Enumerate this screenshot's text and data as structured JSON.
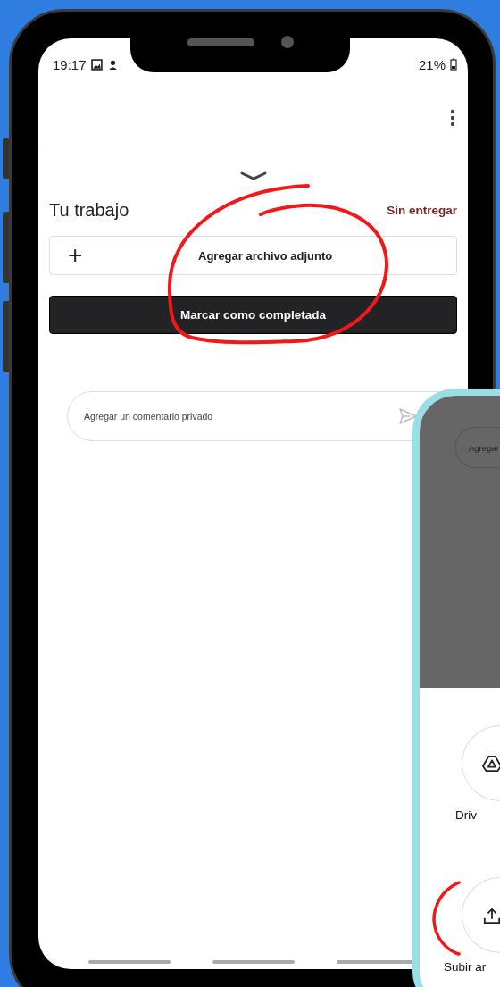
{
  "status_bar": {
    "time": "19:17",
    "battery": "21%"
  },
  "work": {
    "title": "Tu trabajo",
    "status": "Sin entregar",
    "attach_icon": "+",
    "attach_label": "Agregar archivo adjunto",
    "complete_button": "Marcar como completada"
  },
  "comment": {
    "placeholder": "Agregar un comentario privado"
  },
  "second_phone": {
    "comment_placeholder": "Agregar",
    "options": [
      {
        "label": "Driv",
        "kind": "drive"
      },
      {
        "label": "Subir ar",
        "kind": "upload"
      }
    ]
  }
}
